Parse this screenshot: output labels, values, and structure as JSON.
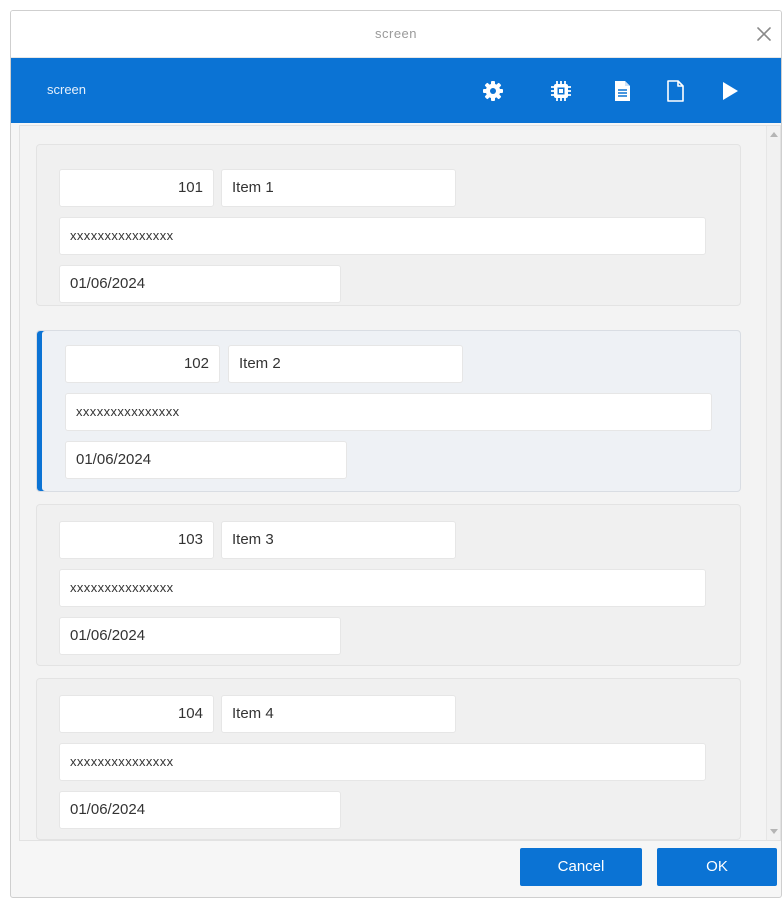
{
  "window": {
    "title": "screen"
  },
  "toolbar": {
    "label": "screen",
    "icons": [
      "gear-icon",
      "chip-icon",
      "document-icon",
      "blank-page-icon",
      "play-icon"
    ]
  },
  "items": [
    {
      "number": "101",
      "name": "Item 1",
      "text": "xxxxxxxxxxxxxxx",
      "date": "01/06/2024",
      "selected": false
    },
    {
      "number": "102",
      "name": "Item 2",
      "text": "xxxxxxxxxxxxxxx",
      "date": "01/06/2024",
      "selected": true
    },
    {
      "number": "103",
      "name": "Item 3",
      "text": "xxxxxxxxxxxxxxx",
      "date": "01/06/2024",
      "selected": false
    },
    {
      "number": "104",
      "name": "Item 4",
      "text": "xxxxxxxxxxxxxxx",
      "date": "01/06/2024",
      "selected": false
    }
  ],
  "buttons": {
    "cancel_label": "Cancel",
    "ok_label": "OK"
  },
  "colors": {
    "accent": "#0b73d4"
  }
}
